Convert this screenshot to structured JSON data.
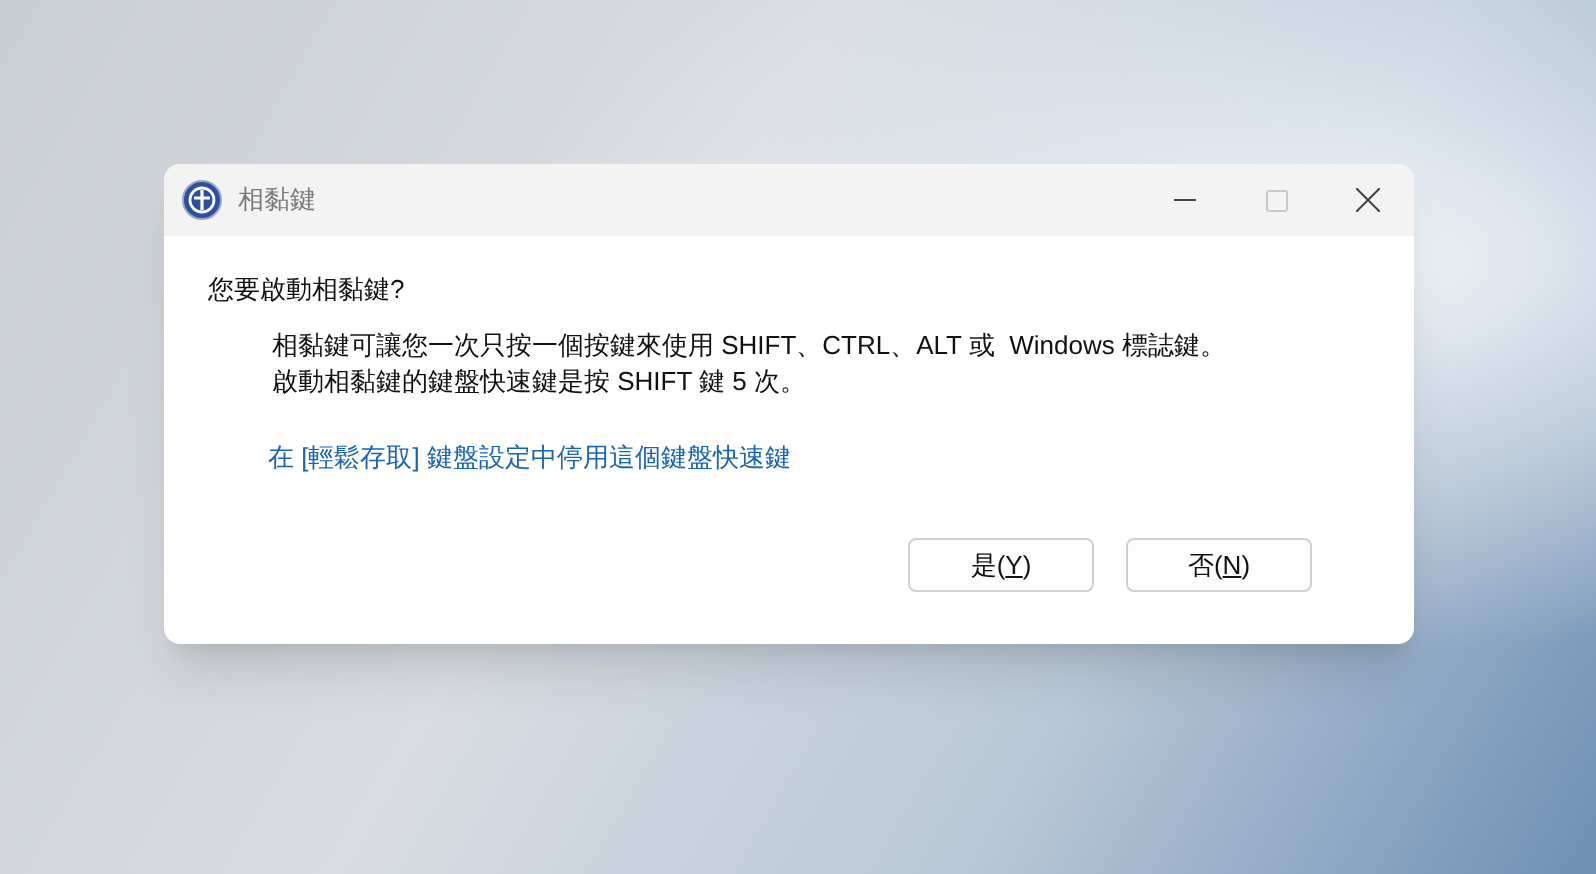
{
  "window": {
    "title": "相黏鍵"
  },
  "heading": "您要啟動相黏鍵?",
  "description": [
    "相黏鍵可讓您一次只按一個按鍵來使用 SHIFT、CTRL、ALT 或  Windows 標誌鍵。",
    "啟動相黏鍵的鍵盤快速鍵是按 SHIFT 鍵 5 次。"
  ],
  "link": "在 [輕鬆存取] 鍵盤設定中停用這個鍵盤快速鍵",
  "buttons": [
    {
      "before": "是(",
      "mnemonic": "Y",
      "after": ")"
    },
    {
      "before": "否(",
      "mnemonic": "N",
      "after": ")"
    }
  ]
}
